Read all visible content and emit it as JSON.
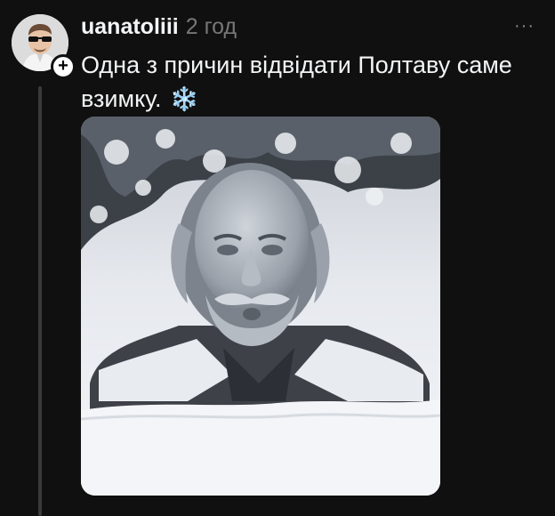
{
  "post": {
    "username": "uanatoliii",
    "time": "2 год",
    "text": "Одна з причин відвідати Полтаву саме взимку.",
    "emoji": "❄️",
    "more_label": "···",
    "follow_label": "+"
  },
  "icons": {
    "avatar": "avatar-man-sunglasses",
    "follow": "plus-icon",
    "more": "ellipsis-icon",
    "emoji": "snowflake-icon"
  },
  "colors": {
    "background": "#101010",
    "text": "#f3f5f7",
    "muted": "#777777",
    "thread_line": "#3a3a3a"
  }
}
